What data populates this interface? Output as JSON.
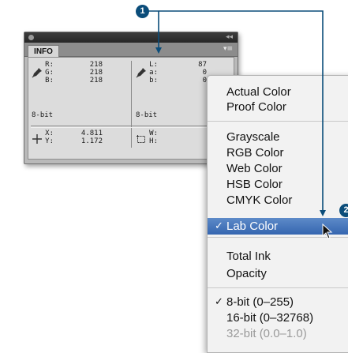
{
  "panel": {
    "tab_label": "INFO",
    "collapse_glyph": "◂◂",
    "menu_glyph": "▾≡",
    "left_top": {
      "labels": [
        "R:",
        "G:",
        "B:"
      ],
      "values": [
        "218",
        "218",
        "218"
      ],
      "bit_depth": "8-bit"
    },
    "right_top": {
      "labels": [
        "L:",
        "a:",
        "b:"
      ],
      "values": [
        "87",
        "0",
        "0"
      ],
      "bit_depth": "8-bit"
    },
    "position": {
      "labels": [
        "X:",
        "Y:"
      ],
      "values": [
        "4.811",
        "1.172"
      ]
    },
    "size": {
      "labels": [
        "W:",
        "H:"
      ]
    }
  },
  "menu": {
    "group1": [
      "Actual Color",
      "Proof Color"
    ],
    "group2": [
      "Grayscale",
      "RGB Color",
      "Web Color",
      "HSB Color",
      "CMYK Color",
      "Lab Color"
    ],
    "selected_item": "Lab Color",
    "group3": [
      "Total Ink",
      "Opacity"
    ],
    "group4": [
      "8-bit (0–255)",
      "16-bit (0–32768)",
      "32-bit (0.0–1.0)"
    ],
    "checked_bit_item": "8-bit (0–255)",
    "disabled_item": "32-bit (0.0–1.0)",
    "check_glyph": "✓"
  },
  "callouts": [
    "1",
    "2"
  ],
  "colors": {
    "callout": "#0b4d7a",
    "menu_highlight": "#3f72bb",
    "panel_bg": "#b9b9b9"
  }
}
